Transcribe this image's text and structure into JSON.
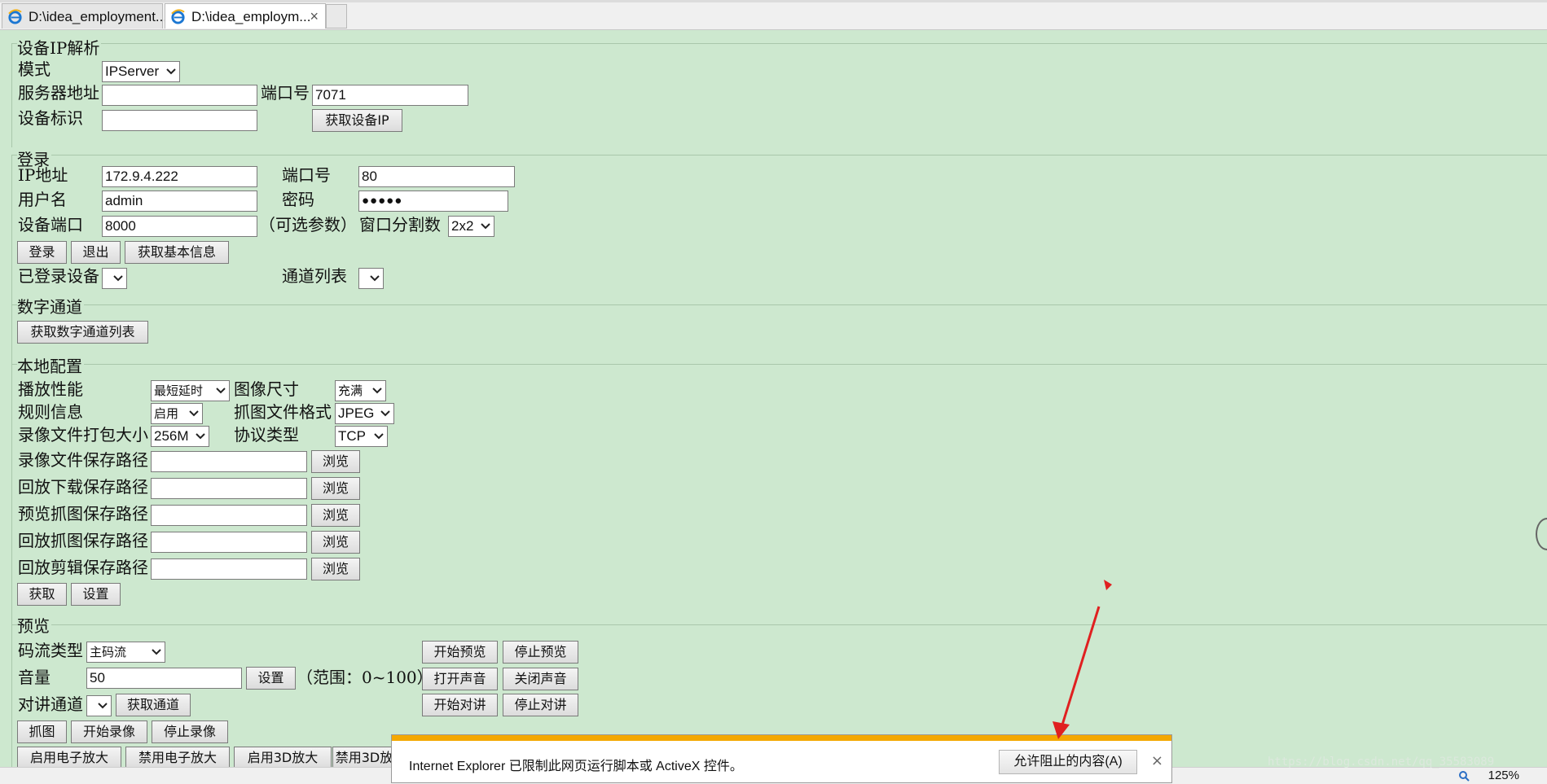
{
  "browser": {
    "tabs": [
      {
        "label": "D:\\idea_employment...",
        "active": false
      },
      {
        "label": "D:\\idea_employm...",
        "active": true
      }
    ],
    "tab_close": "×",
    "zoom": "125%"
  },
  "ip_resolve": {
    "legend": "设备IP解析",
    "mode_label": "模式",
    "mode_value": "IPServer",
    "server_label": "服务器地址",
    "server_value": "",
    "port_label": "端口号",
    "port_value": "7071",
    "device_id_label": "设备标识",
    "device_id_value": "",
    "get_ip_button": "获取设备IP"
  },
  "login": {
    "legend": "登录",
    "ip_label": "IP地址",
    "ip_value": "172.9.4.222",
    "port_label": "端口号",
    "port_value": "80",
    "user_label": "用户名",
    "user_value": "admin",
    "password_label": "密码",
    "password_value": "●●●●●",
    "device_port_label": "设备端口",
    "device_port_value": "8000",
    "optional_note": "（可选参数）",
    "split_label": "窗口分割数",
    "split_value": "2x2",
    "login_button": "登录",
    "logout_button": "退出",
    "info_button": "获取基本信息",
    "logged_devices_label": "已登录设备",
    "channel_list_label": "通道列表"
  },
  "digital": {
    "legend": "数字通道",
    "get_button": "获取数字通道列表"
  },
  "local": {
    "legend": "本地配置",
    "perf_label": "播放性能",
    "perf_value": "最短延时",
    "size_label": "图像尺寸",
    "size_value": "充满",
    "rule_label": "规则信息",
    "rule_value": "启用",
    "capture_format_label": "抓图文件格式",
    "capture_format_value": "JPEG",
    "pack_size_label": "录像文件打包大小",
    "pack_size_value": "256M",
    "protocol_label": "协议类型",
    "protocol_value": "TCP",
    "paths": [
      {
        "label": "录像文件保存路径",
        "value": "",
        "button": "浏览"
      },
      {
        "label": "回放下载保存路径",
        "value": "",
        "button": "浏览"
      },
      {
        "label": "预览抓图保存路径",
        "value": "",
        "button": "浏览"
      },
      {
        "label": "回放抓图保存路径",
        "value": "",
        "button": "浏览"
      },
      {
        "label": "回放剪辑保存路径",
        "value": "",
        "button": "浏览"
      }
    ],
    "get_button": "获取",
    "set_button": "设置"
  },
  "preview": {
    "legend": "预览",
    "stream_label": "码流类型",
    "stream_value": "主码流",
    "volume_label": "音量",
    "volume_value": "50",
    "volume_set_button": "设置",
    "range_note": "（范围：0~100）",
    "talk_label": "对讲通道",
    "get_channel_button": "获取通道",
    "start_preview": "开始预览",
    "stop_preview": "停止预览",
    "open_sound": "打开声音",
    "close_sound": "关闭声音",
    "start_talk": "开始对讲",
    "stop_talk": "停止对讲",
    "capture_button": "抓图",
    "start_record": "开始录像",
    "stop_record": "停止录像",
    "enable_ezoom": "启用电子放大",
    "disable_ezoom": "禁用电子放大",
    "enable_3d": "启用3D放大",
    "disable_3d": "禁用3D放"
  },
  "notification": {
    "message": "Internet Explorer 已限制此网页运行脚本或 ActiveX 控件。",
    "allow_button": "允许阻止的内容(A)",
    "close": "×"
  },
  "watermark": "https://blog.csdn.net/qq_35583089",
  "colors": {
    "page_bg": "#cde8cf",
    "notification_bar": "#f4a800",
    "annotation_arrow": "#e02020"
  }
}
